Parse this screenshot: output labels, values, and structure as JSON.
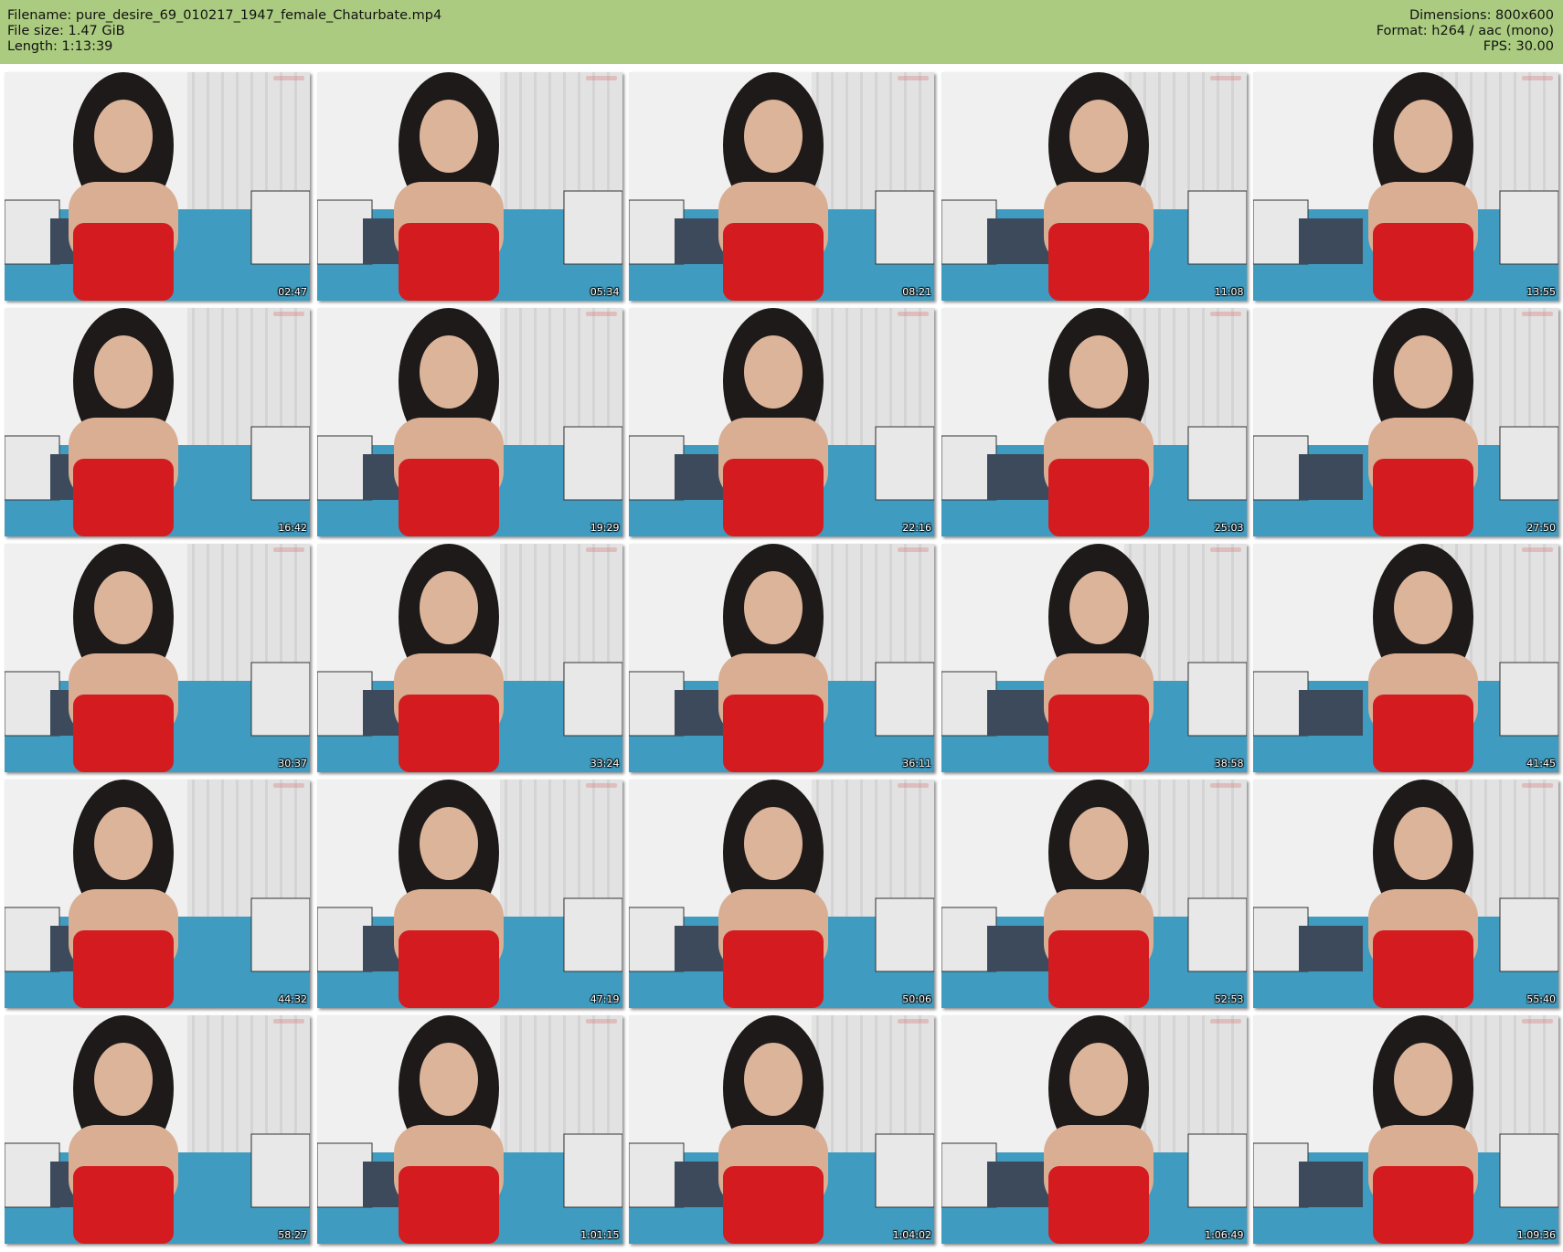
{
  "header": {
    "filename_line": "Filename: pure_desire_69_010217_1947_female_Chaturbate.mp4",
    "filesize_line": "File size: 1.47 GiB",
    "length_line": "Length: 1:13:39",
    "dimensions_line": "Dimensions: 800x600",
    "format_line": "Format: h264 / aac (mono)",
    "fps_line": "FPS: 30.00"
  },
  "colors": {
    "header_bg": "#abcc80",
    "dress": "#d41c20",
    "wall": "#f0f0f0",
    "sofa": "#3f9cc0"
  },
  "thumbnails": [
    {
      "timestamp": "02:47"
    },
    {
      "timestamp": "05:34"
    },
    {
      "timestamp": "08:21"
    },
    {
      "timestamp": "11:08"
    },
    {
      "timestamp": "13:55"
    },
    {
      "timestamp": "16:42"
    },
    {
      "timestamp": "19:29"
    },
    {
      "timestamp": "22:16"
    },
    {
      "timestamp": "25:03"
    },
    {
      "timestamp": "27:50"
    },
    {
      "timestamp": "30:37"
    },
    {
      "timestamp": "33:24"
    },
    {
      "timestamp": "36:11"
    },
    {
      "timestamp": "38:58"
    },
    {
      "timestamp": "41:45"
    },
    {
      "timestamp": "44:32"
    },
    {
      "timestamp": "47:19"
    },
    {
      "timestamp": "50:06"
    },
    {
      "timestamp": "52:53"
    },
    {
      "timestamp": "55:40"
    },
    {
      "timestamp": "58:27"
    },
    {
      "timestamp": "1:01:15"
    },
    {
      "timestamp": "1:04:02"
    },
    {
      "timestamp": "1:06:49"
    },
    {
      "timestamp": "1:09:36"
    }
  ]
}
